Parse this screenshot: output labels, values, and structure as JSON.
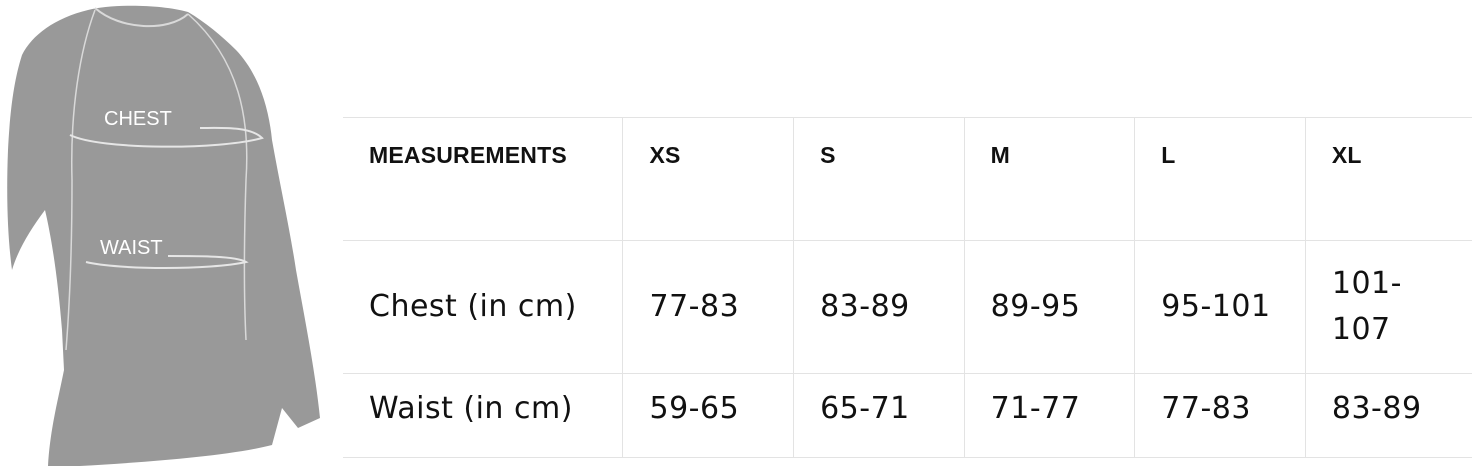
{
  "figure": {
    "chest_label": "CHEST",
    "waist_label": "WAIST",
    "garment_color": "#999999",
    "seam_color": "#d9d9d9"
  },
  "table": {
    "headers": [
      "MEASUREMENTS",
      "XS",
      "S",
      "M",
      "L",
      "XL"
    ],
    "rows": [
      {
        "label": "Chest (in cm)",
        "values": [
          "77-83",
          "83-89",
          "89-95",
          "95-101",
          "101-107"
        ]
      },
      {
        "label": "Waist (in cm)",
        "values": [
          "59-65",
          "65-71",
          "71-77",
          "77-83",
          "83-89"
        ]
      }
    ],
    "border_color": "#e3e3e3"
  }
}
